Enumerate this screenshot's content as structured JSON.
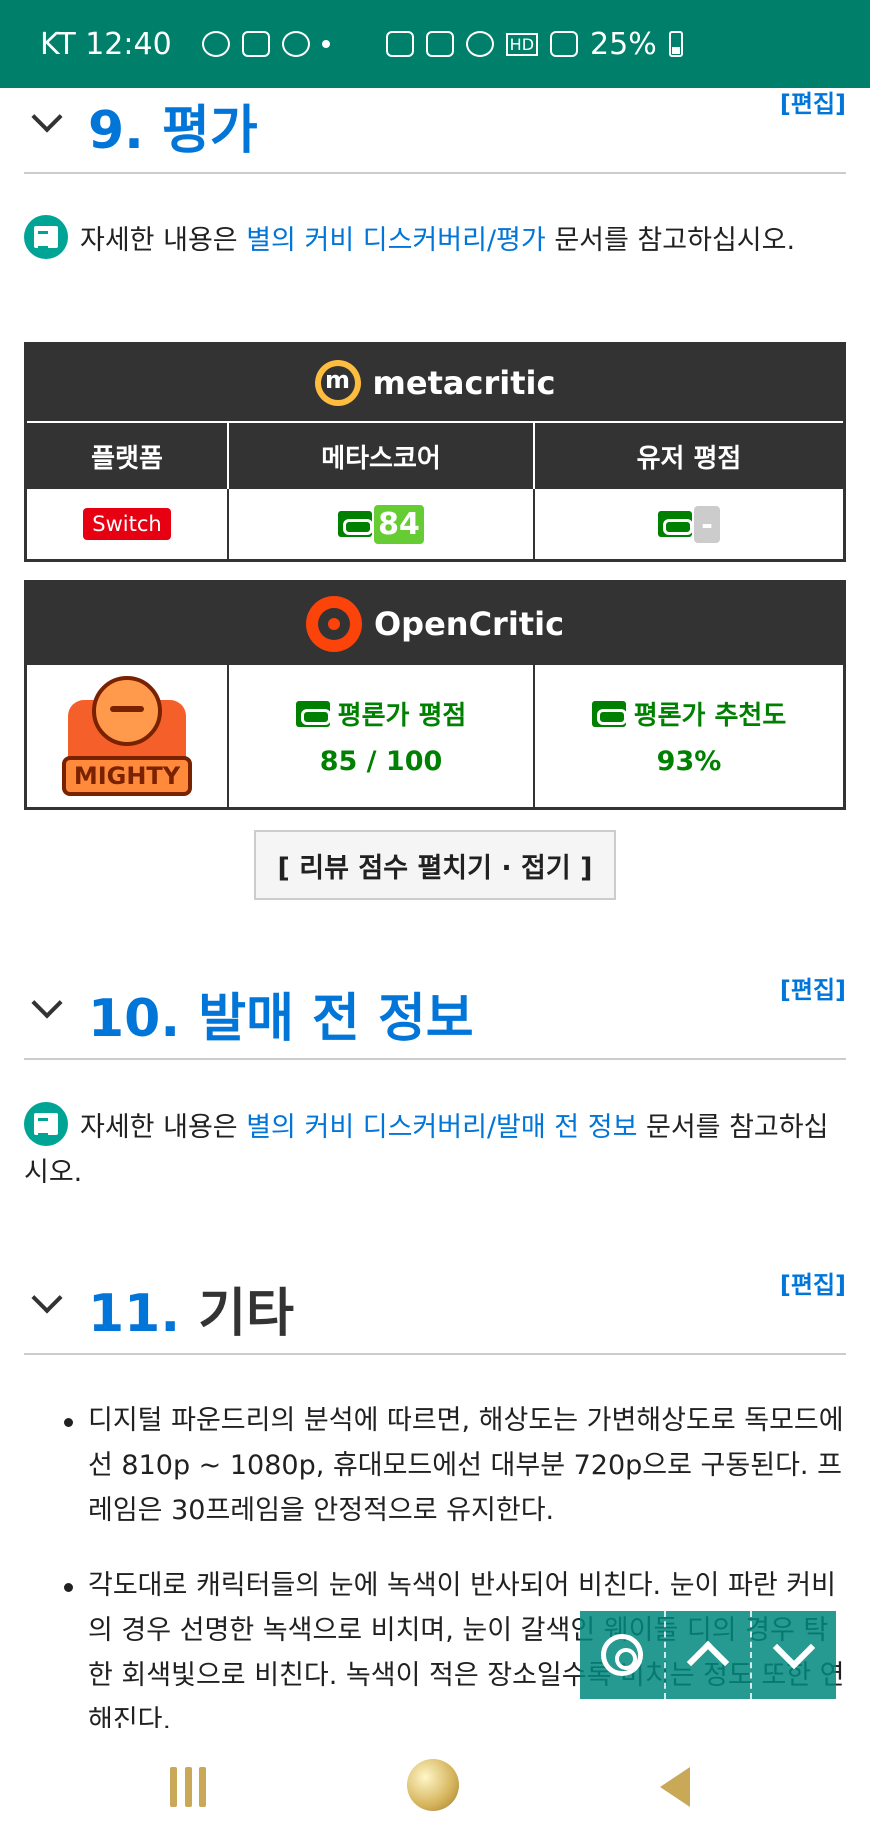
{
  "status_bar": {
    "carrier_time": "KT 12:40",
    "battery": "25%",
    "network": "HD",
    "icons": [
      "chat-bubble-icon",
      "image-icon",
      "talk-icon",
      "dot-icon",
      "key-icon",
      "mute-icon",
      "wifi-icon",
      "hd-icon",
      "signal-icon",
      "battery-icon"
    ]
  },
  "sections": {
    "s9": {
      "number": "9.",
      "title": "평가",
      "edit": "[편집]",
      "note_prefix": "자세한 내용은 ",
      "note_link": "별의 커비 디스커버리/평가",
      "note_suffix": " 문서를 참고하십시오."
    },
    "s10": {
      "number": "10.",
      "title": "발매 전 정보",
      "edit": "[편집]",
      "note_prefix": "자세한 내용은 ",
      "note_link": "별의 커비 디스커버리/발매 전 정보",
      "note_suffix": " 문서를 참고하십시오."
    },
    "s11": {
      "number": "11.",
      "title": "기타",
      "edit": "[편집]",
      "bullets": [
        "디지털 파운드리의 분석에 따르면, 해상도는 가변해상도로 독모드에선 810p ~ 1080p, 휴대모드에선 대부분 720p으로 구동된다. 프레임은 30프레임을 안정적으로 유지한다.",
        "각도대로 캐릭터들의 눈에 녹색이 반사되어 비친다. 눈이 파란 커비의 경우 선명한 녹색으로 비치며, 눈이 갈색인 웨이들 디의 경우 탁한 회색빛으로 비친다. 녹색이 적은 장소일수록 비치는 정도 또한 연해진다."
      ]
    }
  },
  "metacritic": {
    "brand": "metacritic",
    "logo_letter": "m",
    "headers": [
      "플랫폼",
      "메타스코어",
      "유저 평점"
    ],
    "platform": "Switch",
    "metascore": "84",
    "user_score": "-"
  },
  "opencritic": {
    "brand": "OpenCritic",
    "tier": "MIGHTY",
    "critic_score_label": "평론가 평점",
    "critic_score": "85 / 100",
    "recommend_label": "평론가 추천도",
    "recommend": "93%"
  },
  "review_toggle": "[ 리뷰 점수 펼치기 · 접기 ]",
  "colors": {
    "status_bar": "#00806a",
    "heading_blue": "#0275d8",
    "link_green": "#008000",
    "switch_red": "#e60012",
    "metascore_green": "#66cc33"
  }
}
